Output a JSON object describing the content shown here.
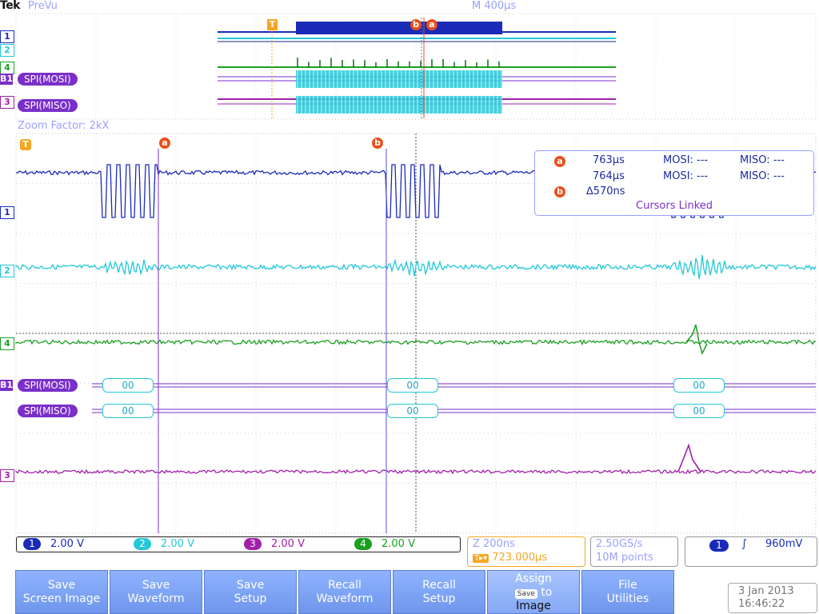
{
  "header": {
    "brand": "Tek",
    "mode": "PreVu",
    "timebase": "M 400µs"
  },
  "overview": {
    "trigger_marker": "T",
    "cursor_marker_b": "b",
    "cursor_marker_a": "a",
    "channels": [
      "1",
      "2",
      "4",
      "B1",
      "3"
    ],
    "bus_mosi_label": "SPI(MOSI)",
    "bus_miso_label": "SPI(MISO)"
  },
  "zoom_factor": "Zoom Factor: 2kX",
  "main": {
    "trigger_marker": "T",
    "cursor_a": "a",
    "cursor_b": "b",
    "channel_labels": {
      "ch1": "1",
      "ch2": "2",
      "ch4": "4",
      "b1": "B1",
      "ch3": "3"
    },
    "bus_mosi_label": "SPI(MOSI)",
    "bus_miso_label": "SPI(MISO)",
    "mosi_packets": [
      "00",
      "00",
      "00"
    ],
    "miso_packets": [
      "00",
      "00",
      "00"
    ]
  },
  "cursor_readout": {
    "a_icon": "a",
    "a_time": "763µs",
    "a_mosi": "MOSI: ---",
    "a_miso": "MISO: ---",
    "b_time": "764µs",
    "b_mosi": "MOSI: ---",
    "b_miso": "MISO: ---",
    "b_icon": "b",
    "delta": "∆570ns",
    "linked": "Cursors Linked"
  },
  "channels": [
    {
      "num": "1",
      "scale": "2.00 V",
      "color": "#1a2bb8"
    },
    {
      "num": "2",
      "scale": "2.00 V",
      "color": "#22c8d8"
    },
    {
      "num": "3",
      "scale": "2.00 V",
      "color": "#a020a8"
    },
    {
      "num": "4",
      "scale": "2.00 V",
      "color": "#1aa020"
    }
  ],
  "zoom": {
    "scale": "Z 200ns",
    "position": "723.000µs"
  },
  "acquisition": {
    "rate": "2.50GS/s",
    "points": "10M points"
  },
  "trigger": {
    "source": "1",
    "slope_icon": "rising-edge-icon",
    "level": "960mV"
  },
  "buttons": [
    {
      "line1": "Save",
      "line2": "Screen Image"
    },
    {
      "line1": "Save",
      "line2": "Waveform"
    },
    {
      "line1": "Save",
      "line2": "Setup"
    },
    {
      "line1": "Recall",
      "line2": "Waveform"
    },
    {
      "line1": "Recall",
      "line2": "Setup"
    },
    {
      "line1": "Assign",
      "icon": "Save",
      "to": "to",
      "line2": "Image"
    },
    {
      "line1": "File",
      "line2": "Utilities"
    }
  ],
  "datetime": {
    "date": "3 Jan  2013",
    "time": "16:46:22"
  },
  "colors": {
    "ch1": "#1a2bb8",
    "ch2": "#22c8d8",
    "ch3": "#a020a8",
    "ch4": "#1aa020",
    "bus": "#7a2fc8",
    "trigger": "#f5a623",
    "cursor": "#e8501c"
  }
}
